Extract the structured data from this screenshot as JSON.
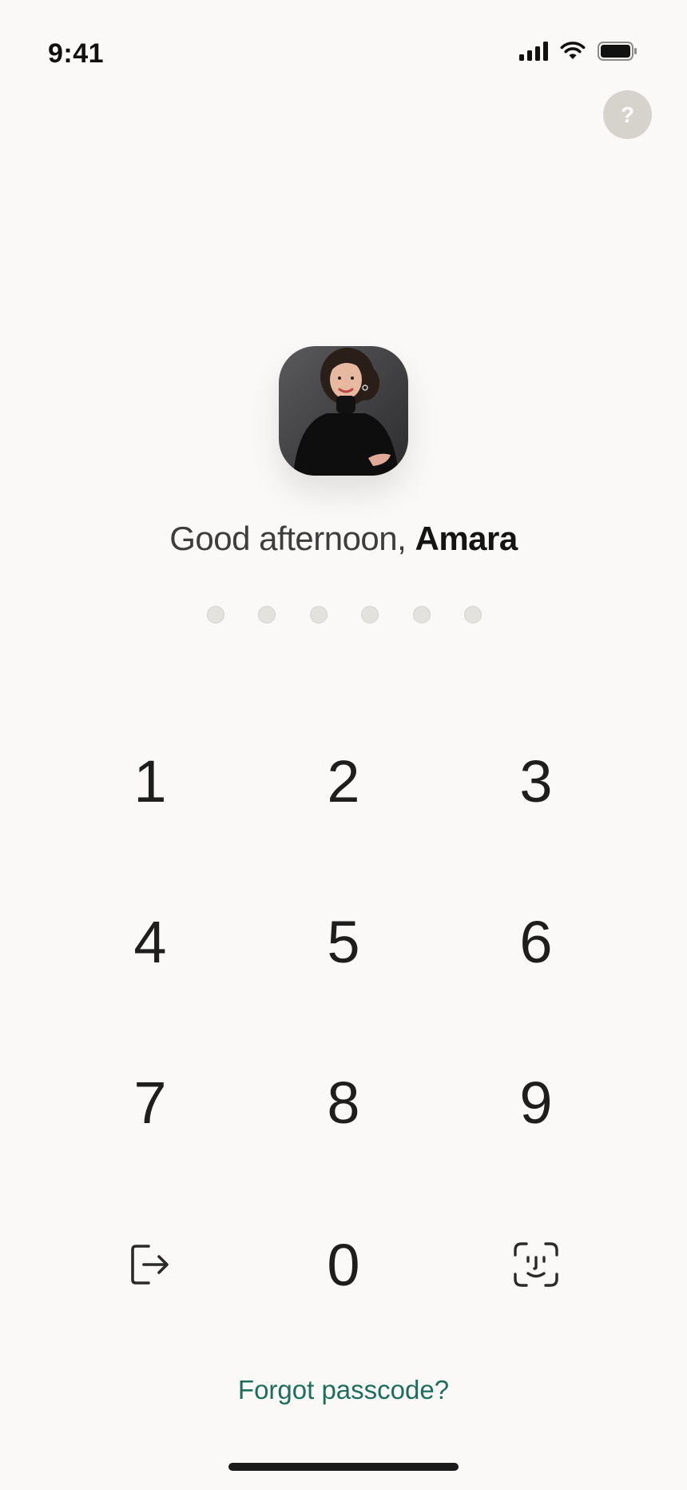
{
  "status_bar": {
    "time": "9:41",
    "icons": [
      "cellular-signal-icon",
      "wifi-icon",
      "battery-icon"
    ]
  },
  "help": {
    "label": "?"
  },
  "user": {
    "avatar": "profile-photo",
    "greeting_prefix": "Good afternoon, ",
    "name": "Amara"
  },
  "passcode": {
    "length": 6,
    "entered": 0
  },
  "keypad": {
    "keys": [
      "1",
      "2",
      "3",
      "4",
      "5",
      "6",
      "7",
      "8",
      "9",
      "0"
    ],
    "left_action_icon": "sign-out-icon",
    "right_action_icon": "face-id-icon"
  },
  "forgot_label": "Forgot passcode?",
  "colors": {
    "background": "#faf9f7",
    "accent": "#1f6e5c",
    "dot_empty": "#e3e2dc",
    "help_bg": "#d6d3cc"
  }
}
